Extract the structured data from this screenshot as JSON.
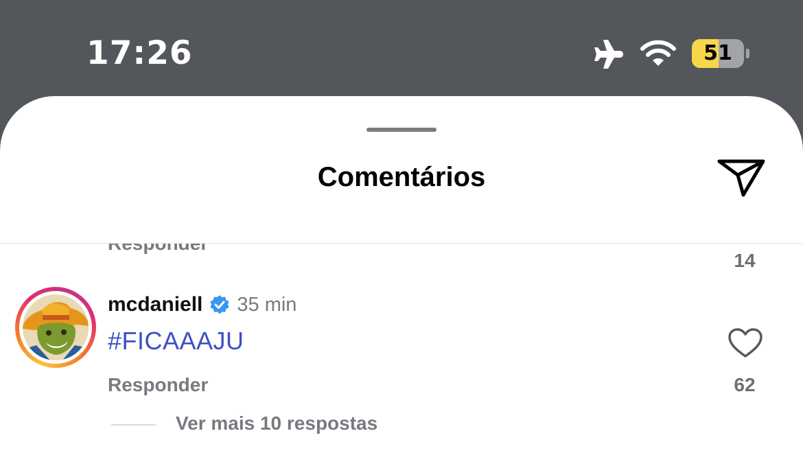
{
  "status_bar": {
    "time": "17:26",
    "battery_level": 51,
    "battery_fill_color": "#f7d749",
    "icons": [
      "airplane-icon",
      "wifi-icon",
      "battery-icon"
    ]
  },
  "sheet": {
    "title": "Comentários",
    "share_icon": "paper-plane-icon"
  },
  "previous_comment": {
    "reply_label": "Responder",
    "like_count": "14"
  },
  "comment": {
    "username": "mcdaniell",
    "verified": true,
    "verified_color": "#3897f0",
    "time_ago": "35 min",
    "text": "#FICAAAJU",
    "text_color": "#3c4fc4",
    "reply_label": "Responder",
    "like_count": "62",
    "view_replies_label": "Ver mais 10 respostas"
  }
}
